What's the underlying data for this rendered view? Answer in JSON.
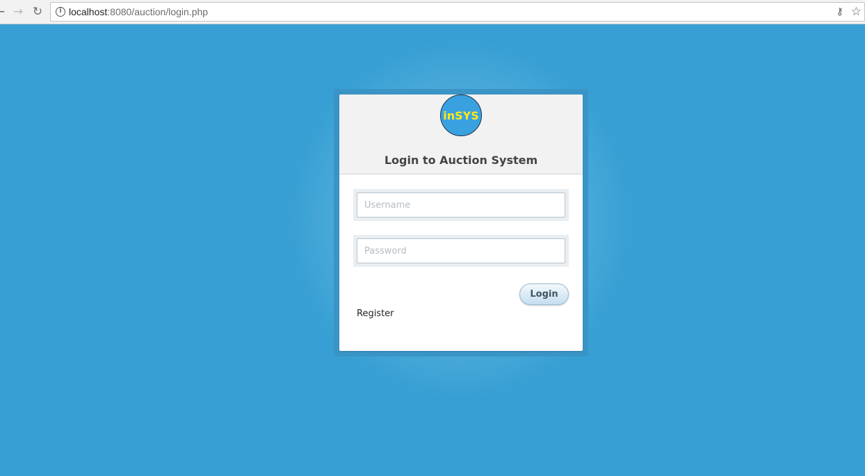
{
  "browser": {
    "url_host": "localhost",
    "url_rest": ":8080/auction/login.php",
    "icons": {
      "back": "back-arrow-icon",
      "forward": "forward-arrow-icon",
      "reload": "reload-icon",
      "info": "info-icon",
      "key": "key-icon",
      "bookmark": "star-icon"
    }
  },
  "login_card": {
    "logo_text": "inSYS",
    "title": "Login to Auction System",
    "username": {
      "placeholder": "Username",
      "value": ""
    },
    "password": {
      "placeholder": "Password",
      "value": ""
    },
    "login_label": "Login",
    "register_label": "Register"
  },
  "colors": {
    "page_background": "#379fd3",
    "logo_fill": "#3aa1e0",
    "logo_text": "#ffe81a",
    "card_header": "#f2f2f2"
  }
}
